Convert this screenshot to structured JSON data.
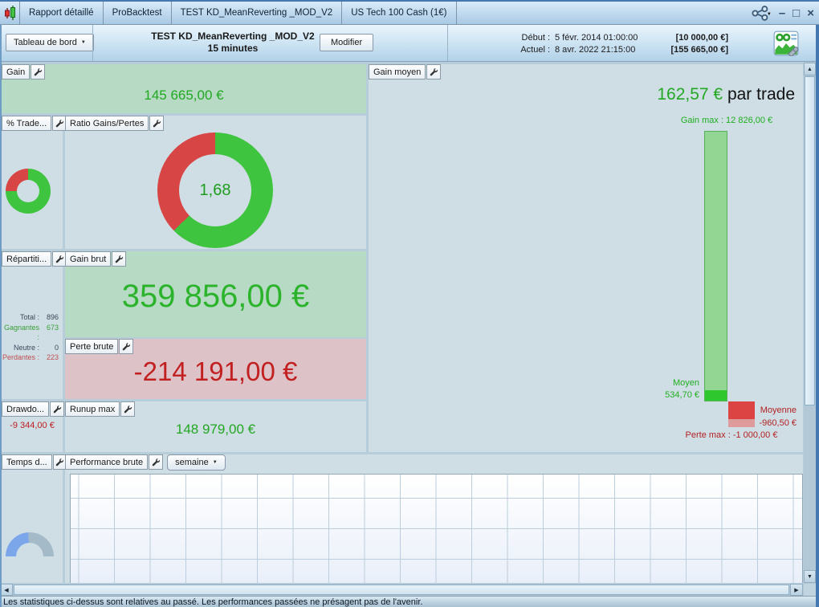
{
  "window": {
    "tabs": [
      "Rapport détaillé",
      "ProBacktest",
      "TEST KD_MeanReverting _MOD_V2",
      "US Tech 100 Cash (1€)"
    ],
    "controls": {
      "minimize": "–",
      "maximize": "□",
      "close": "×"
    }
  },
  "toolbar": {
    "view_selector": "Tableau de bord",
    "strategy_name": "TEST KD_MeanReverting _MOD_V2",
    "timeframe": "15 minutes",
    "modify_button": "Modifier",
    "start": {
      "label": "Début :",
      "datetime": "5 févr. 2014 01:00:00",
      "capital": "[10 000,00 €]"
    },
    "current": {
      "label": "Actuel :",
      "datetime": "8 avr. 2022 21:15:00",
      "capital": "[155 665,00 €]"
    }
  },
  "panels": {
    "gain": {
      "title": "Gain",
      "value": "145 665,00 €"
    },
    "pct_trades": {
      "title": "% Trade..."
    },
    "ratio": {
      "title": "Ratio Gains/Pertes",
      "value": "1,68"
    },
    "repartition": {
      "title": "Répartiti...",
      "rows": [
        {
          "label": "Total :",
          "value": "896"
        },
        {
          "label": "Gagnantes :",
          "value": "673"
        },
        {
          "label": "Neutre :",
          "value": "0"
        },
        {
          "label": "Perdantes :",
          "value": "223"
        }
      ]
    },
    "gain_brut": {
      "title": "Gain brut",
      "value": "359 856,00 €"
    },
    "perte_brute": {
      "title": "Perte brute",
      "value": "-214 191,00 €"
    },
    "drawdown": {
      "title": "Drawdo...",
      "value": "-9 344,00 €"
    },
    "runup_max": {
      "title": "Runup max",
      "value": "148 979,00 €"
    },
    "gain_moyen": {
      "title": "Gain moyen",
      "average": "162,57 €",
      "average_suffix": " par trade",
      "gain_max_label": "Gain max : 12 826,00 €",
      "moyen_label": "Moyen",
      "moyen_value": "534,70 €",
      "moyenne_label": "Moyenne",
      "moyenne_value": "-960,50 €",
      "perte_max_label": "Perte max : -1 000,00 €"
    },
    "temps": {
      "title": "Temps d..."
    },
    "performance": {
      "title": "Performance brute",
      "period_selector": "semaine"
    }
  },
  "chart_data": [
    {
      "type": "pie",
      "name": "trades-repartition-donut",
      "slices": [
        {
          "label": "Gagnantes",
          "pct": 75.1,
          "color": "#3ec43e"
        },
        {
          "label": "Perdantes",
          "pct": 24.9,
          "color": "#d84545"
        }
      ]
    },
    {
      "type": "pie",
      "name": "ratio-gains-pertes-donut",
      "center_label": "1,68",
      "slices": [
        {
          "label": "Gains",
          "pct": 62.7,
          "color": "#3ec43e"
        },
        {
          "label": "Pertes",
          "pct": 37.3,
          "color": "#d84545"
        }
      ]
    },
    {
      "type": "bar",
      "name": "gain-moyen-bars",
      "ylim": [
        -1000,
        12826
      ],
      "bars": [
        {
          "label": "Gain max",
          "value": 12826.0
        },
        {
          "label": "Moyen",
          "value": 534.7
        },
        {
          "label": "Moyenne",
          "value": -960.5
        },
        {
          "label": "Perte max",
          "value": -1000.0
        }
      ]
    },
    {
      "type": "gauge",
      "name": "temps-gauge",
      "pct": 48,
      "colors": [
        "#7ba6ea",
        "#a4bac8"
      ]
    },
    {
      "type": "area",
      "name": "performance-brute-chart",
      "period": "semaine",
      "values": [],
      "note": "empty grid, no data plotted"
    }
  ],
  "icons": {
    "caret_down": "▼",
    "scroll_up": "▲",
    "scroll_down": "▼",
    "scroll_left": "◀",
    "scroll_right": "▶"
  },
  "footer": {
    "disclaimer": "Les statistiques ci-dessus sont relatives au passé. Les performances passées ne présagent pas de l'avenir."
  },
  "colors": {
    "gain_green": "#2cb32c",
    "loss_red": "#c22020",
    "panel_green_bg": "#b6dac4",
    "panel_red_bg": "#ddc3c8",
    "donut_green": "#3ec43e",
    "donut_red": "#d84545"
  }
}
